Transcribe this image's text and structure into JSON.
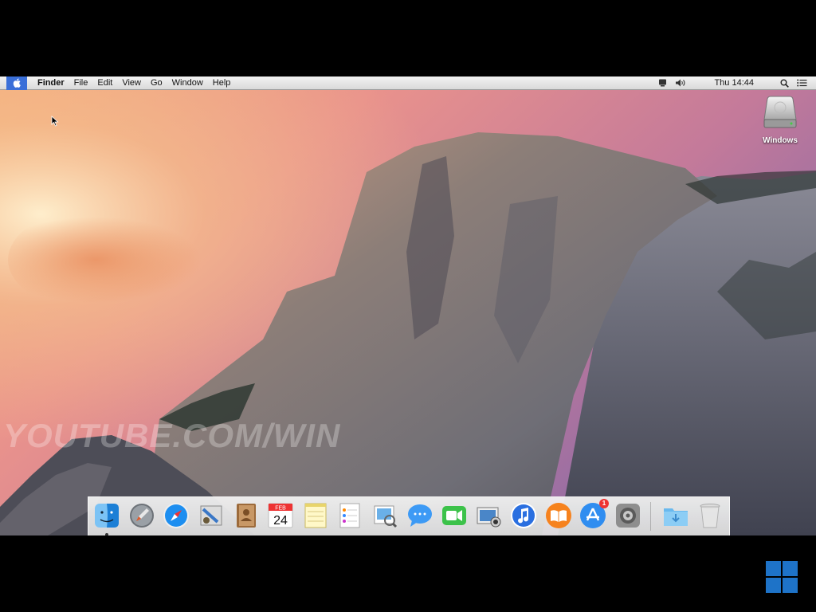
{
  "menubar": {
    "app_name": "Finder",
    "menus": [
      "File",
      "Edit",
      "View",
      "Go",
      "Window",
      "Help"
    ],
    "clock": "Thu 14:44",
    "status_icons": [
      "display-icon",
      "volume-icon",
      "spotlight-icon",
      "notification-center-icon"
    ]
  },
  "desktop": {
    "drive_label": "Windows",
    "watermark": "YOUTUBE.COM/WIN"
  },
  "dock": {
    "items": [
      {
        "name": "finder-icon",
        "running": true
      },
      {
        "name": "launchpad-icon"
      },
      {
        "name": "safari-icon"
      },
      {
        "name": "mail-icon"
      },
      {
        "name": "contacts-icon"
      },
      {
        "name": "calendar-icon",
        "month": "FEB",
        "day": "24"
      },
      {
        "name": "notes-icon"
      },
      {
        "name": "reminders-icon"
      },
      {
        "name": "preview-icon"
      },
      {
        "name": "messages-icon"
      },
      {
        "name": "facetime-icon"
      },
      {
        "name": "photo-icon"
      },
      {
        "name": "itunes-icon"
      },
      {
        "name": "ibooks-icon"
      },
      {
        "name": "app-store-icon",
        "badge": "1"
      },
      {
        "name": "system-preferences-icon"
      },
      {
        "name": "downloads-folder-icon"
      },
      {
        "name": "trash-icon"
      }
    ]
  },
  "colors": {
    "menu_highlight": "#3a6fd8",
    "windows_logo": "#1e73c8"
  }
}
